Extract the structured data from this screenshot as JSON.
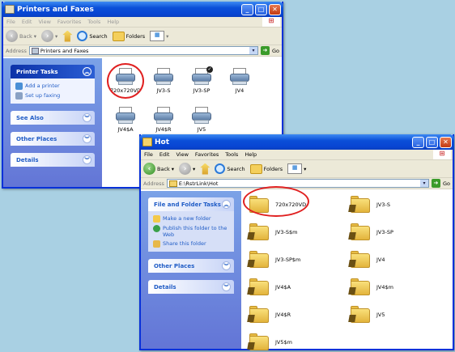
{
  "window1": {
    "title": "Printers and Faxes",
    "menu": [
      "File",
      "Edit",
      "View",
      "Favorites",
      "Tools",
      "Help"
    ],
    "toolbar": {
      "back": "Back",
      "search": "Search",
      "folders": "Folders"
    },
    "address": {
      "label": "Address",
      "value": "Printers and Faxes",
      "go": "Go"
    },
    "tasks": [
      {
        "title": "Printer Tasks",
        "items": [
          "Add a printer",
          "Set up faxing"
        ]
      },
      {
        "title": "See Also"
      },
      {
        "title": "Other Places"
      },
      {
        "title": "Details"
      }
    ],
    "printers": [
      "720x720VD",
      "JV3-S",
      "JV3-SP",
      "JV4",
      "JV4$A",
      "JV4$R",
      "JV5"
    ]
  },
  "window2": {
    "title": "Hot",
    "menu": [
      "File",
      "Edit",
      "View",
      "Favorites",
      "Tools",
      "Help"
    ],
    "toolbar": {
      "back": "Back",
      "search": "Search",
      "folders": "Folders"
    },
    "address": {
      "label": "Address",
      "value": "E:\\RstrLink\\Hot",
      "go": "Go"
    },
    "tasks": [
      {
        "title": "File and Folder Tasks",
        "items": [
          "Make a new folder",
          "Publish this folder to the Web",
          "Share this folder"
        ]
      },
      {
        "title": "Other Places"
      },
      {
        "title": "Details"
      }
    ],
    "folders": [
      "720x720VD",
      "JV3-S",
      "JV3-S$m",
      "JV3-SP",
      "JV3-SP$m",
      "JV4",
      "JV4$A",
      "JV4$m",
      "JV4$R",
      "JV5",
      "JV5$m"
    ]
  },
  "colors": {
    "highlight": "#e02020",
    "titlebar": "#0b4fd8",
    "taskpane": "#6375d6"
  }
}
